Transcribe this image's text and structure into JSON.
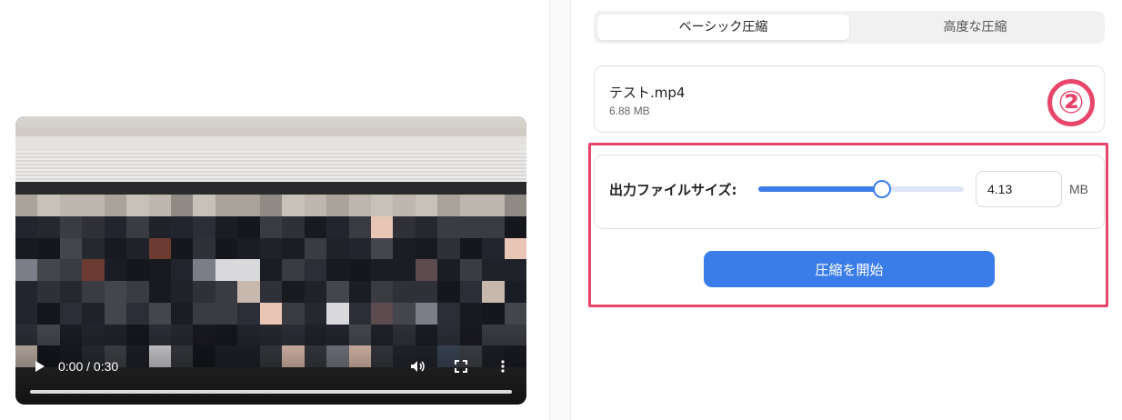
{
  "video": {
    "time_display": "0:00 / 0:30",
    "icons": {
      "play": "play-icon",
      "volume": "volume-icon",
      "fullscreen": "fullscreen-icon",
      "more": "more-vertical-icon"
    },
    "progress": 0
  },
  "tabs": [
    {
      "label": "ベーシック圧縮",
      "active": true
    },
    {
      "label": "高度な圧縮",
      "active": false
    }
  ],
  "file": {
    "name": "テスト.mp4",
    "size": "6.88 MB"
  },
  "annotation": {
    "step_badge": "②",
    "color": "#e8456a"
  },
  "output_size": {
    "label": "出力ファイルサイズ:",
    "value": "4.13",
    "unit": "MB",
    "slider_fraction": 0.6
  },
  "actions": {
    "start_label": "圧縮を開始"
  },
  "colors": {
    "accent": "#3b7de8",
    "highlight": "#e8456a"
  }
}
